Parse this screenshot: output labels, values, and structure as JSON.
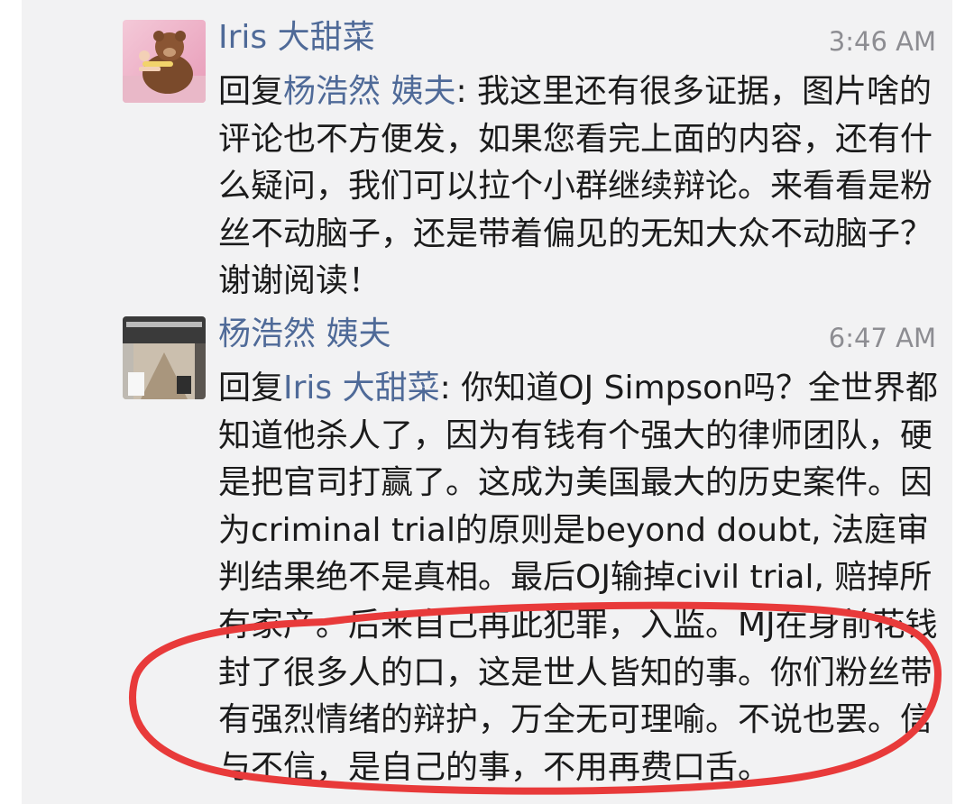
{
  "comments": [
    {
      "author": "Iris 大甜菜",
      "time": "3:46 AM",
      "reply_prefix": "回复",
      "reply_to": "杨浩然 姨夫",
      "text": ": 我这里还有很多证据，图片啥的评论也不方便发，如果您看完上面的内容，还有什么疑问，我们可以拉个小群继续辩论。来看看是粉丝不动脑子，还是带着偏见的无知大众不动脑子？谢谢阅读！"
    },
    {
      "author": "杨浩然 姨夫",
      "time": "6:47 AM",
      "reply_prefix": "回复",
      "reply_to": "Iris 大甜菜",
      "text": ": 你知道OJ Simpson吗？全世界都知道他杀人了，因为有钱有个强大的律师团队，硬是把官司打赢了。这成为美国最大的历史案件。因为criminal trial的原则是beyond doubt, 法庭审判结果绝不是真相。最后OJ输掉civil trial, 赔掉所有家产。后来自己再此犯罪，入监。MJ在身前花钱封了很多人的口，这是世人皆知的事。你们粉丝带有强烈情绪的辩护，万全无可理喻。不说也罢。信与不信，是自己的事，不用再费口舌。"
    }
  ],
  "colors": {
    "name": "#4f6a98",
    "time": "#8d8d92",
    "text": "#1b1b1b",
    "background": "#f2f2f3",
    "annotation": "#e83a3a"
  }
}
